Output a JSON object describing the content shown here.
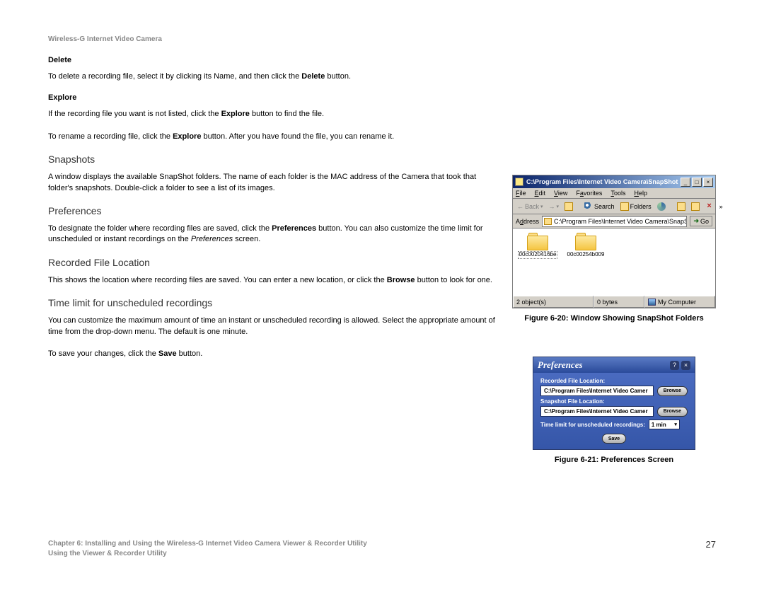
{
  "doc_title": "Wireless-G Internet Video Camera",
  "sections": {
    "delete_h": "Delete",
    "delete_p": "To delete a recording file, select it by clicking its Name, and then click the Delete button.",
    "explore_h": "Explore",
    "explore_p1": "If the recording file you want is not listed, click the Explore button to find the file.",
    "explore_p2": "To rename a recording file, click the Explore button. After you have found the file, you can rename it.",
    "snapshots_h": "Snapshots",
    "snapshots_p": "A window displays the available SnapShot folders. The name of each folder is the MAC address of the Camera that took that folder's snapshots. Double-click a folder to see a list of its images.",
    "prefs_h": "Preferences",
    "prefs_p": "To designate the folder where recording files are saved, click the Preferences button. You can also customize the time limit for unscheduled or instant recordings on the Preferences screen.",
    "rec_loc_h": "Recorded File Location",
    "rec_loc_p": "This shows the location where recording files are saved. You can enter a new location, or click the Browse button to look for one.",
    "timelimit_h": "Time limit for unscheduled recordings",
    "timelimit_p1": "You can customize the maximum amount of time an instant or unscheduled recording is allowed. Select the appropriate amount of time from the drop-down menu. The default is one minute.",
    "timelimit_p2": "To save your changes, click the Save button."
  },
  "figure1": {
    "caption": "Figure 6-20: Window Showing SnapShot Folders",
    "title": "C:\\Program Files\\Internet Video Camera\\SnapShot",
    "menu": {
      "file": "File",
      "edit": "Edit",
      "view": "View",
      "favorites": "Favorites",
      "tools": "Tools",
      "help": "Help"
    },
    "back": "Back",
    "search": "Search",
    "folders": "Folders",
    "address_label": "Address",
    "address_value": "C:\\Program Files\\Internet Video Camera\\SnapShot",
    "go": "Go",
    "items": [
      "00c0020416be",
      "00c00254b009"
    ],
    "status_objects": "2 object(s)",
    "status_bytes": "0 bytes",
    "status_location": "My Computer"
  },
  "figure2": {
    "caption": "Figure 6-21: Preferences Screen",
    "title": "Preferences",
    "rec_label": "Recorded File Location:",
    "rec_value": "C:\\Program Files\\Internet Video Camer",
    "snap_label": "Snapshot File Location:",
    "snap_value": "C:\\Program Files\\Internet Video Camer",
    "browse": "Browse",
    "timelimit_label": "Time limit for unscheduled recordings:",
    "timelimit_value": "1 min",
    "save": "Save"
  },
  "footer": {
    "chapter": "Chapter 6: Installing and Using the Wireless-G Internet Video Camera Viewer & Recorder Utility",
    "section": "Using the Viewer & Recorder Utility",
    "page": "27"
  }
}
